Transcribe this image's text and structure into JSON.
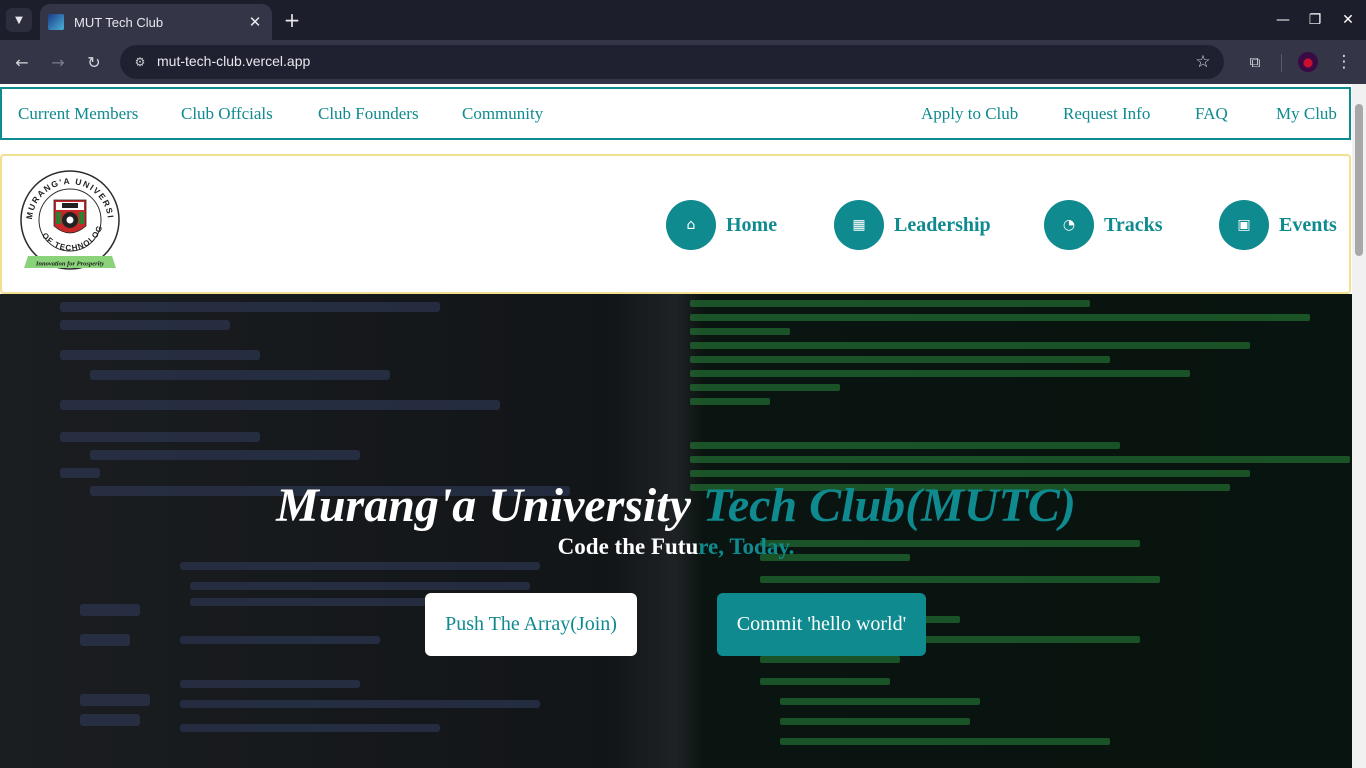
{
  "browser": {
    "tab_title": "MUT Tech Club",
    "tab_close": "✕",
    "new_tab": "+",
    "url": "mut-tech-club.vercel.app",
    "icons": {
      "tab_list": "▼",
      "back": "←",
      "forward": "→",
      "reload": "↻",
      "site_info": "⚙",
      "bookmark": "☆",
      "extensions": "⧉",
      "menu": "⋮",
      "minimize": "—",
      "maximize": "❐",
      "close": "✕"
    }
  },
  "topnav": {
    "left": [
      "Current Members",
      "Club Offcials",
      "Club Founders",
      "Community"
    ],
    "right": [
      "Apply to Club",
      "Request Info",
      "FAQ",
      "My Club"
    ]
  },
  "header": {
    "logo_alt": "Murang'a University of Technology logo",
    "logo_ring_top": "MURANG'A UNIVERSITY",
    "logo_ring_bottom": "OF TECHNOLOGY",
    "logo_motto": "Innovation for Prosperity",
    "nav": [
      {
        "label": "Home",
        "icon": "home-icon"
      },
      {
        "label": "Leadership",
        "icon": "building-icon"
      },
      {
        "label": "Tracks",
        "icon": "track-icon"
      },
      {
        "label": "Events",
        "icon": "calendar-icon"
      }
    ]
  },
  "hero": {
    "title_part1": "Murang'a University ",
    "title_part2": "Tech Club(MUTC)",
    "subtitle_part1": "Code the Futu",
    "subtitle_part2": "re, Today.",
    "join_button": "Push The Array(Join)",
    "commit_button": "Commit 'hello world'"
  },
  "colors": {
    "brand_teal": "#0f8a8f",
    "header_border": "#f2df8f",
    "browser_dark": "#1d1e2b"
  }
}
